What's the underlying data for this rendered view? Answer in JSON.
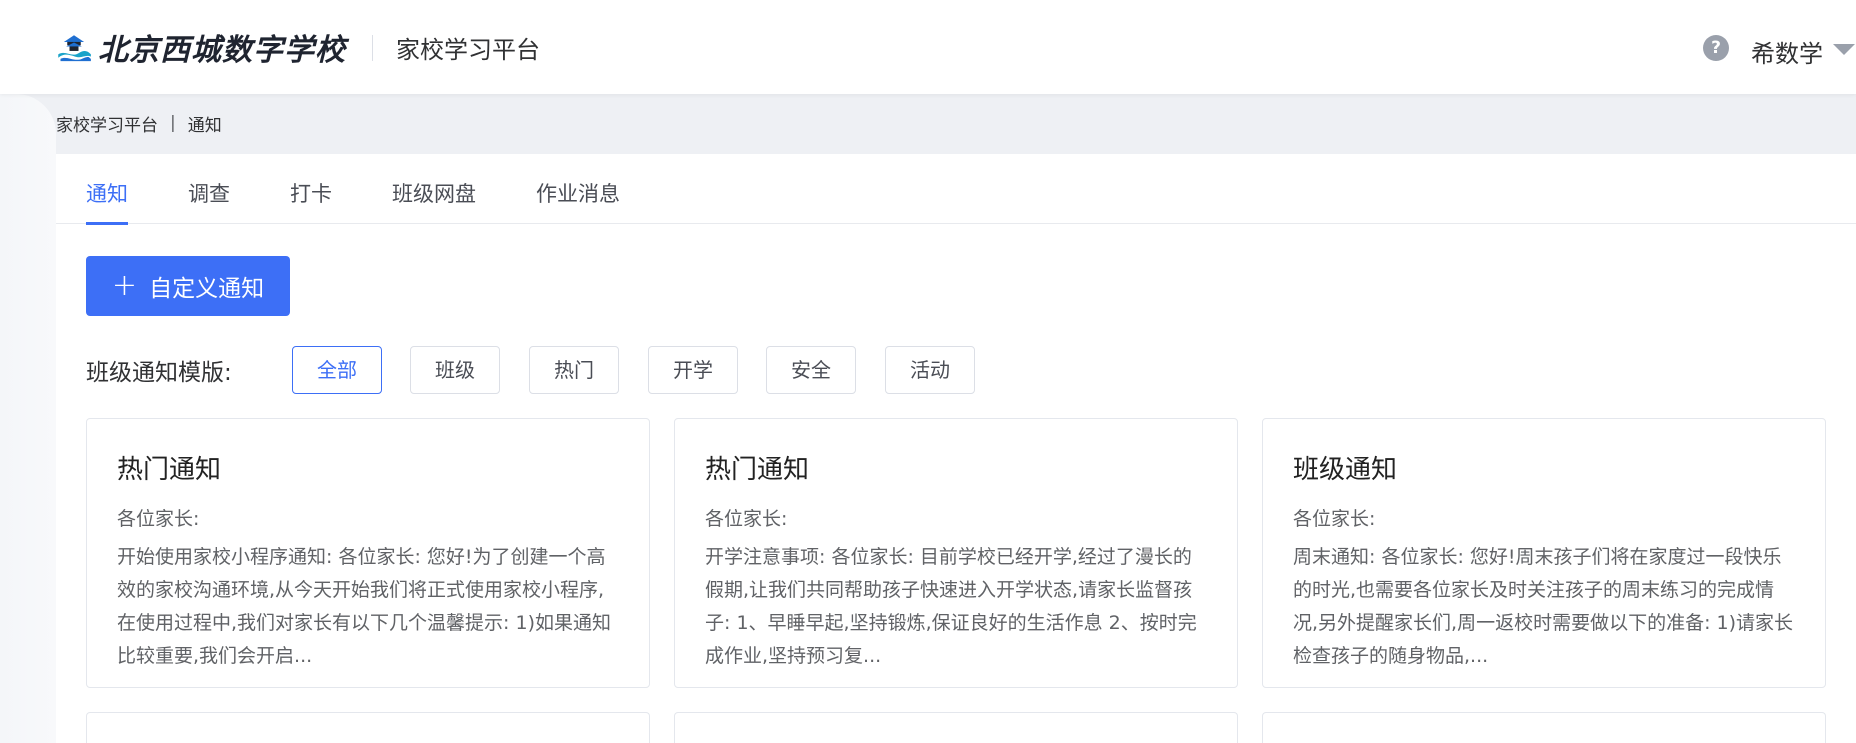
{
  "header": {
    "logo_text": "北京西城数字学校",
    "platform_name": "家校学习平台",
    "help_glyph": "?",
    "username": "希数学"
  },
  "breadcrumb": {
    "root": "家校学习平台",
    "separator": "|",
    "current": "通知"
  },
  "tabs": [
    {
      "label": "通知",
      "active": true
    },
    {
      "label": "调查",
      "active": false
    },
    {
      "label": "打卡",
      "active": false
    },
    {
      "label": "班级网盘",
      "active": false
    },
    {
      "label": "作业消息",
      "active": false
    }
  ],
  "create_button": {
    "icon": "plus-icon",
    "glyph": "+",
    "label": "自定义通知"
  },
  "template_filter": {
    "label": "班级通知模版:",
    "chips": [
      {
        "label": "全部",
        "active": true
      },
      {
        "label": "班级",
        "active": false
      },
      {
        "label": "热门",
        "active": false
      },
      {
        "label": "开学",
        "active": false
      },
      {
        "label": "安全",
        "active": false
      },
      {
        "label": "活动",
        "active": false
      }
    ]
  },
  "cards": [
    {
      "title": "热门通知",
      "salutation": "各位家长:",
      "body": "开始使用家校小程序通知: 各位家长: 您好!为了创建一个高效的家校沟通环境,从今天开始我们将正式使用家校小程序,在使用过程中,我们对家长有以下几个温馨提示: 1)如果通知比较重要,我们会开启..."
    },
    {
      "title": "热门通知",
      "salutation": "各位家长:",
      "body": "开学注意事项: 各位家长: 目前学校已经开学,经过了漫长的假期,让我们共同帮助孩子快速进入开学状态,请家长监督孩子: 1、早睡早起,坚持锻炼,保证良好的生活作息 2、按时完成作业,坚持预习复..."
    },
    {
      "title": "班级通知",
      "salutation": "各位家长:",
      "body": "周末通知: 各位家长: 您好!周末孩子们将在家度过一段快乐的时光,也需要各位家长及时关注孩子的周末练习的完成情况,另外提醒家长们,周一返校时需要做以下的准备: 1)请家长检查孩子的随身物品,..."
    }
  ],
  "colors": {
    "accent": "#3d6ff6",
    "page_bg": "#eef0f4",
    "text": "#303133",
    "muted_text": "#606266",
    "border": "#dcdfe6"
  }
}
